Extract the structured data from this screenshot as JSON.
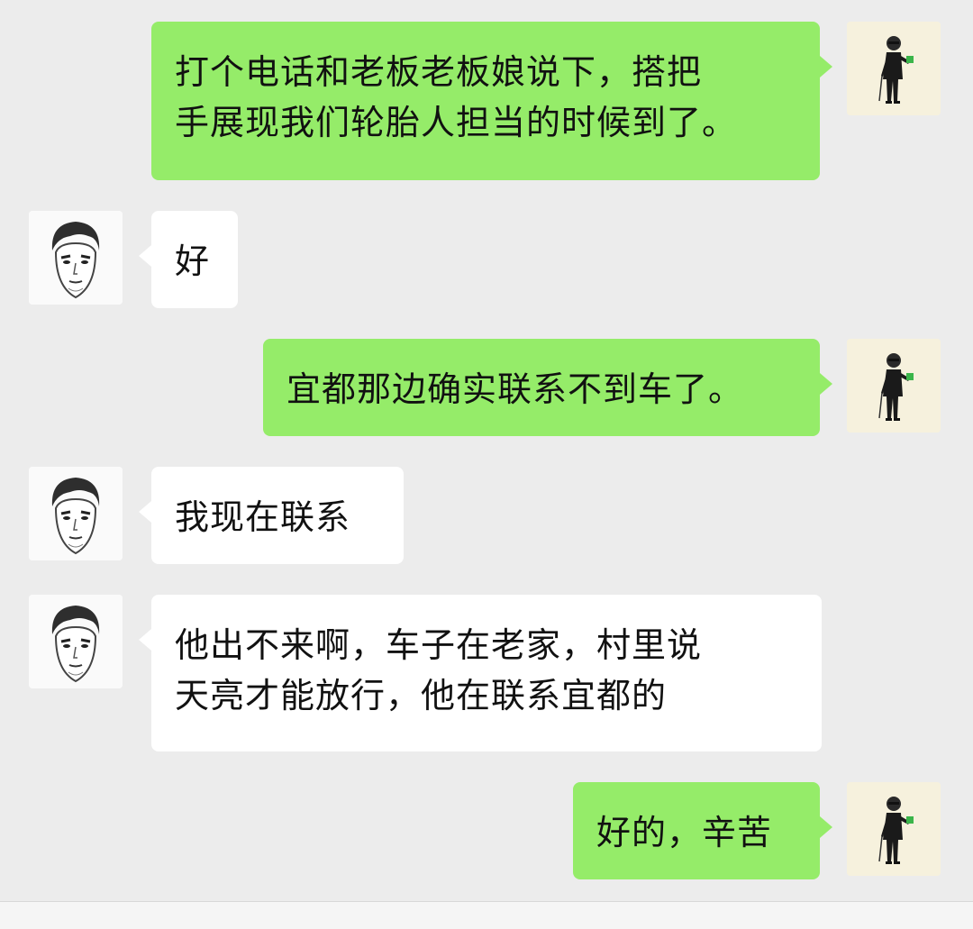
{
  "messages": [
    {
      "sender": "self",
      "avatar": "man-in-black-suit-avatar",
      "lines": [
        "打个电话和老板老板娘说下，搭把",
        "手展现我们轮胎人担当的时候到了。"
      ]
    },
    {
      "sender": "other",
      "avatar": "sketch-face-avatar",
      "lines": [
        "好"
      ]
    },
    {
      "sender": "self",
      "avatar": "man-in-black-suit-avatar",
      "lines": [
        "宜都那边确实联系不到车了。"
      ]
    },
    {
      "sender": "other",
      "avatar": "sketch-face-avatar",
      "lines": [
        "我现在联系"
      ]
    },
    {
      "sender": "other",
      "avatar": "sketch-face-avatar",
      "lines": [
        "他出不来啊，车子在老家，村里说",
        "天亮才能放行，他在联系宜都的"
      ]
    },
    {
      "sender": "self",
      "avatar": "man-in-black-suit-avatar",
      "lines": [
        "好的，辛苦"
      ]
    }
  ],
  "colors": {
    "self_bubble": "#95ec69",
    "other_bubble": "#ffffff",
    "background": "#ececec"
  }
}
